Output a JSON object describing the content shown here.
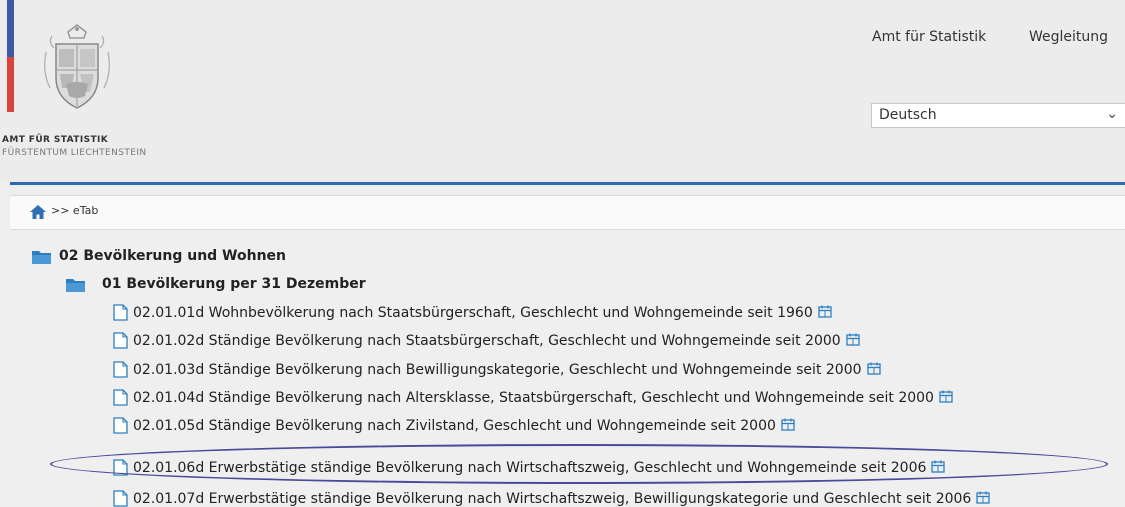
{
  "header": {
    "org_name": "AMT FÜR STATISTIK",
    "org_sub": "FÜRSTENTUM LIECHTENSTEIN",
    "links": [
      "Amt für Statistik",
      "Wegleitung"
    ],
    "language": "Deutsch"
  },
  "breadcrumb": {
    "text": ">> eTab"
  },
  "tree": {
    "category": "02 Bevölkerung und Wohnen",
    "subcategory": "01 Bevölkerung per 31 Dezember",
    "items": [
      "02.01.01d Wohnbevölkerung nach Staatsbürgerschaft, Geschlecht und Wohngemeinde seit 1960",
      "02.01.02d Ständige Bevölkerung nach Staatsbürgerschaft, Geschlecht und Wohngemeinde seit 2000",
      "02.01.03d Ständige Bevölkerung nach Bewilligungskategorie, Geschlecht und Wohngemeinde seit 2000",
      "02.01.04d Ständige Bevölkerung nach Altersklasse, Staatsbürgerschaft, Geschlecht und Wohngemeinde seit 2000",
      "02.01.05d Ständige Bevölkerung nach Zivilstand, Geschlecht und Wohngemeinde seit 2000",
      "02.01.06d Erwerbstätige ständige Bevölkerung nach Wirtschaftszweig, Geschlecht und Wohngemeinde seit 2006",
      "02.01.07d Erwerbstätige ständige Bevölkerung nach Wirtschaftszweig, Bewilligungskategorie und Geschlecht seit 2006"
    ]
  },
  "colors": {
    "accent": "#2b6cb0",
    "flag_blue": "#3d5aa6",
    "flag_red": "#d9443e",
    "highlight": "#4a4a9a"
  }
}
